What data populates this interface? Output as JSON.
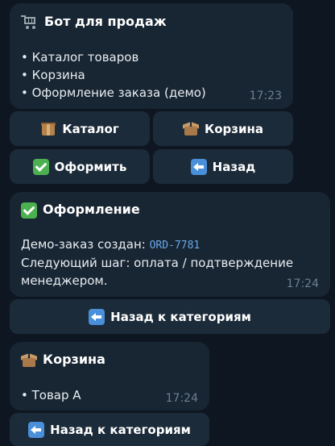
{
  "messages": [
    {
      "title": "Бот для продаж",
      "title_icon": "shopping-cart-icon",
      "lines": [
        "• Каталог товаров",
        "• Корзина",
        "• Оформление заказа (демо)"
      ],
      "time": "17:23",
      "buttons": [
        {
          "label": "Каталог",
          "icon": "package-icon"
        },
        {
          "label": "Корзина",
          "icon": "open-box-icon"
        },
        {
          "label": "Оформить",
          "icon": "check-mark-icon"
        },
        {
          "label": "Назад",
          "icon": "back-arrow-icon"
        }
      ]
    },
    {
      "title": "Оформление",
      "title_icon": "check-mark-icon",
      "line1_prefix": "Демо-заказ создан: ",
      "order_code": "ORD-7781",
      "line2": "Следующий шаг: оплата / подтверждение",
      "line3": "менеджером.",
      "time": "17:24",
      "button": {
        "label": "Назад к категориям",
        "icon": "back-arrow-icon"
      }
    },
    {
      "title": "Корзина",
      "title_icon": "open-box-icon",
      "lines": [
        "• Товар А"
      ],
      "time": "17:24",
      "button": {
        "label": "Назад к категориям",
        "icon": "back-arrow-icon"
      }
    }
  ],
  "colors": {
    "background": "#0e1621",
    "bubble": "#182533",
    "button": "#1c2b3a",
    "time_text": "#6d7f8f",
    "code_text": "#6aa8e8"
  }
}
